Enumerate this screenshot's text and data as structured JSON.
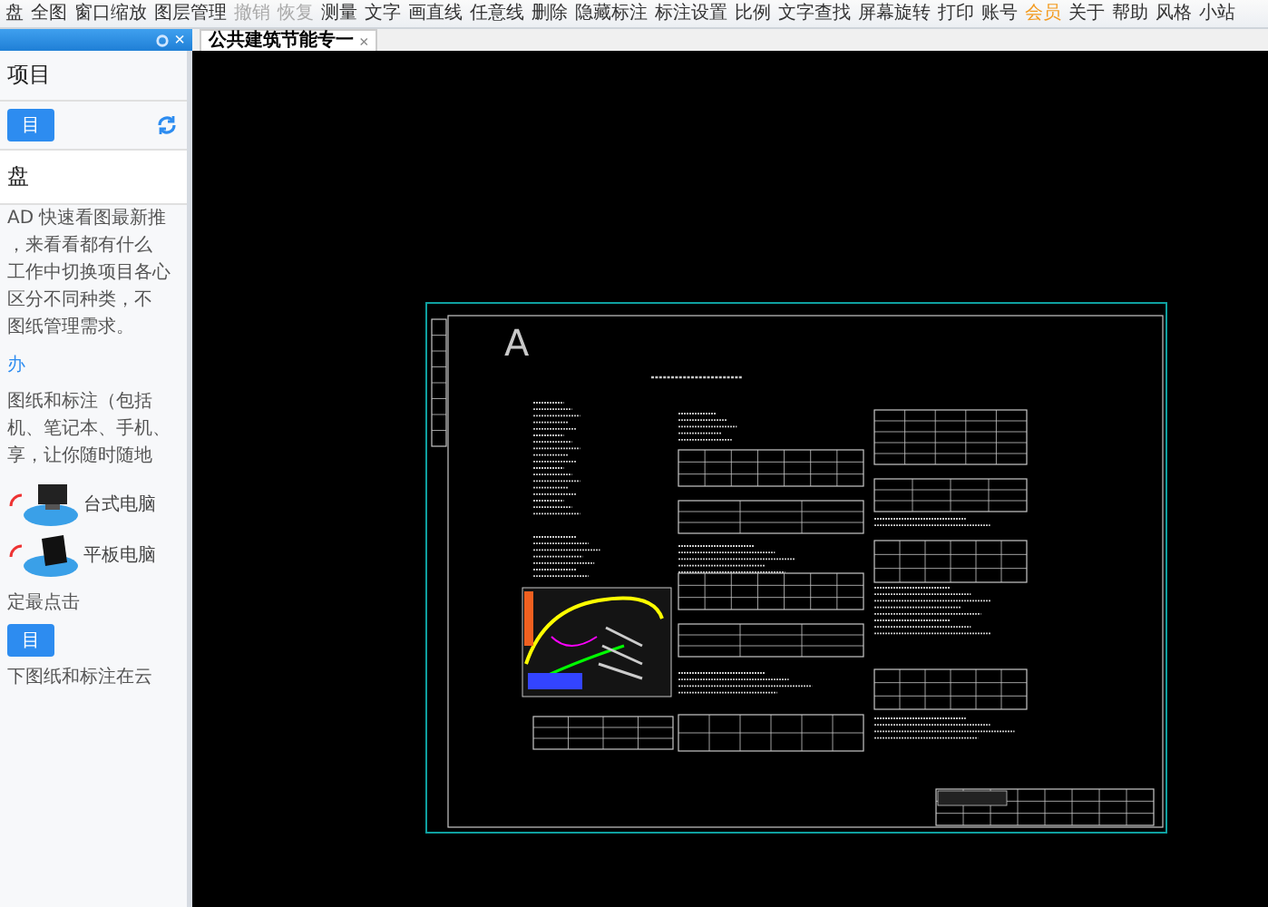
{
  "toolbar": {
    "items": [
      {
        "label": "盘",
        "disabled": false,
        "highlighted": false
      },
      {
        "label": "全图",
        "disabled": false,
        "highlighted": false
      },
      {
        "label": "窗口缩放",
        "disabled": false,
        "highlighted": false
      },
      {
        "label": "图层管理",
        "disabled": false,
        "highlighted": false
      },
      {
        "label": "撤销",
        "disabled": true,
        "highlighted": false
      },
      {
        "label": "恢复",
        "disabled": true,
        "highlighted": false
      },
      {
        "label": "测量",
        "disabled": false,
        "highlighted": false
      },
      {
        "label": "文字",
        "disabled": false,
        "highlighted": false
      },
      {
        "label": "画直线",
        "disabled": false,
        "highlighted": false
      },
      {
        "label": "任意线",
        "disabled": false,
        "highlighted": false
      },
      {
        "label": "删除",
        "disabled": false,
        "highlighted": false
      },
      {
        "label": "隐藏标注",
        "disabled": false,
        "highlighted": false
      },
      {
        "label": "标注设置",
        "disabled": false,
        "highlighted": false
      },
      {
        "label": "比例",
        "disabled": false,
        "highlighted": false
      },
      {
        "label": "文字查找",
        "disabled": false,
        "highlighted": false
      },
      {
        "label": "屏幕旋转",
        "disabled": false,
        "highlighted": false
      },
      {
        "label": "打印",
        "disabled": false,
        "highlighted": false
      },
      {
        "label": "账号",
        "disabled": false,
        "highlighted": false
      },
      {
        "label": "会员",
        "disabled": false,
        "highlighted": true
      },
      {
        "label": "关于",
        "disabled": false,
        "highlighted": false
      },
      {
        "label": "帮助",
        "disabled": false,
        "highlighted": false
      },
      {
        "label": "风格",
        "disabled": false,
        "highlighted": false
      },
      {
        "label": "小站",
        "disabled": false,
        "highlighted": false
      }
    ]
  },
  "side_panel": {
    "close": "×",
    "title": "项目",
    "button": "目",
    "blocks": [
      {
        "kind": "heading",
        "text": "盘"
      },
      {
        "kind": "text",
        "text": "AD 快速看图最新推"
      },
      {
        "kind": "text",
        "text": "，来看看都有什么"
      },
      {
        "kind": "text",
        "text": "工作中切换项目各心"
      },
      {
        "kind": "text",
        "text": "区分不同种类，不"
      },
      {
        "kind": "text",
        "text": "图纸管理需求。"
      },
      {
        "kind": "link",
        "text": "办"
      },
      {
        "kind": "text",
        "text": "图纸和标注（包括"
      },
      {
        "kind": "text",
        "text": "机、笔记本、手机、"
      },
      {
        "kind": "text",
        "text": "享，让你随时随地"
      },
      {
        "kind": "devices",
        "labels": [
          "台式电脑",
          "平板电脑"
        ]
      },
      {
        "kind": "text",
        "text": "定最点击"
      },
      {
        "kind": "button",
        "text": "目"
      },
      {
        "kind": "text",
        "text": "下图纸和标注在云"
      }
    ]
  },
  "tabs": [
    {
      "label": "公共建筑节能专一",
      "selected": true,
      "close": "×"
    }
  ],
  "drawing": {
    "sheet_label": "A"
  }
}
